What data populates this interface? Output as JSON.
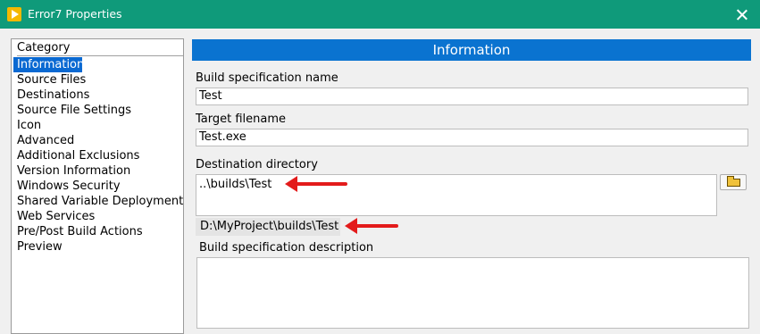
{
  "window": {
    "title": "Error7 Properties"
  },
  "category": {
    "header": "Category",
    "items": [
      "Information",
      "Source Files",
      "Destinations",
      "Source File Settings",
      "Icon",
      "Advanced",
      "Additional Exclusions",
      "Version Information",
      "Windows Security",
      "Shared Variable Deployment",
      "Web Services",
      "Pre/Post Build Actions",
      "Preview"
    ],
    "selected": "Information"
  },
  "info": {
    "header": "Information",
    "build_spec_label": "Build specification name",
    "build_spec_value": "Test",
    "target_label": "Target filename",
    "target_value": "Test.exe",
    "dest_label": "Destination directory",
    "dest_value": "..\\builds\\Test",
    "dest_resolved": "D:\\MyProject\\builds\\Test",
    "desc_label": "Build specification description",
    "desc_value": ""
  },
  "icons": {
    "browse": "folder-open-icon",
    "app": "labview-app-icon",
    "close": "close-icon"
  },
  "colors": {
    "titlebar": "#0f9a7a",
    "header": "#0a73d0",
    "selection": "#0a69d2",
    "annotation_arrow": "#e31b1b"
  }
}
